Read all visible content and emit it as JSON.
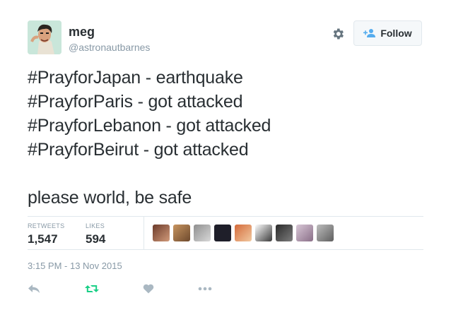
{
  "user": {
    "display_name": "meg",
    "handle": "@astronautbarnes"
  },
  "follow_button": {
    "label": "Follow"
  },
  "tweet": {
    "lines": [
      "#PrayforJapan - earthquake",
      "#PrayforParis - got attacked",
      "#PrayforLebanon - got attacked",
      "#PrayforBeirut - got attacked",
      "",
      "please world, be safe"
    ],
    "hashtags": [
      "#PrayforJapan",
      "#PrayforParis",
      "#PrayforLebanon",
      "#PrayforBeirut"
    ]
  },
  "stats": {
    "retweets_label": "RETWEETS",
    "retweets_value": "1,547",
    "likes_label": "LIKES",
    "likes_value": "594"
  },
  "timestamp": "3:15 PM - 13 Nov 2015",
  "icons": {
    "settings": "gear-icon",
    "follow": "add-user-icon",
    "reply": "reply-icon",
    "retweet": "retweet-icon",
    "like": "heart-icon",
    "more": "more-icon"
  },
  "colors": {
    "retweet_accent": "#19cf86",
    "muted": "#8899a6",
    "follow_icon": "#55acee"
  }
}
